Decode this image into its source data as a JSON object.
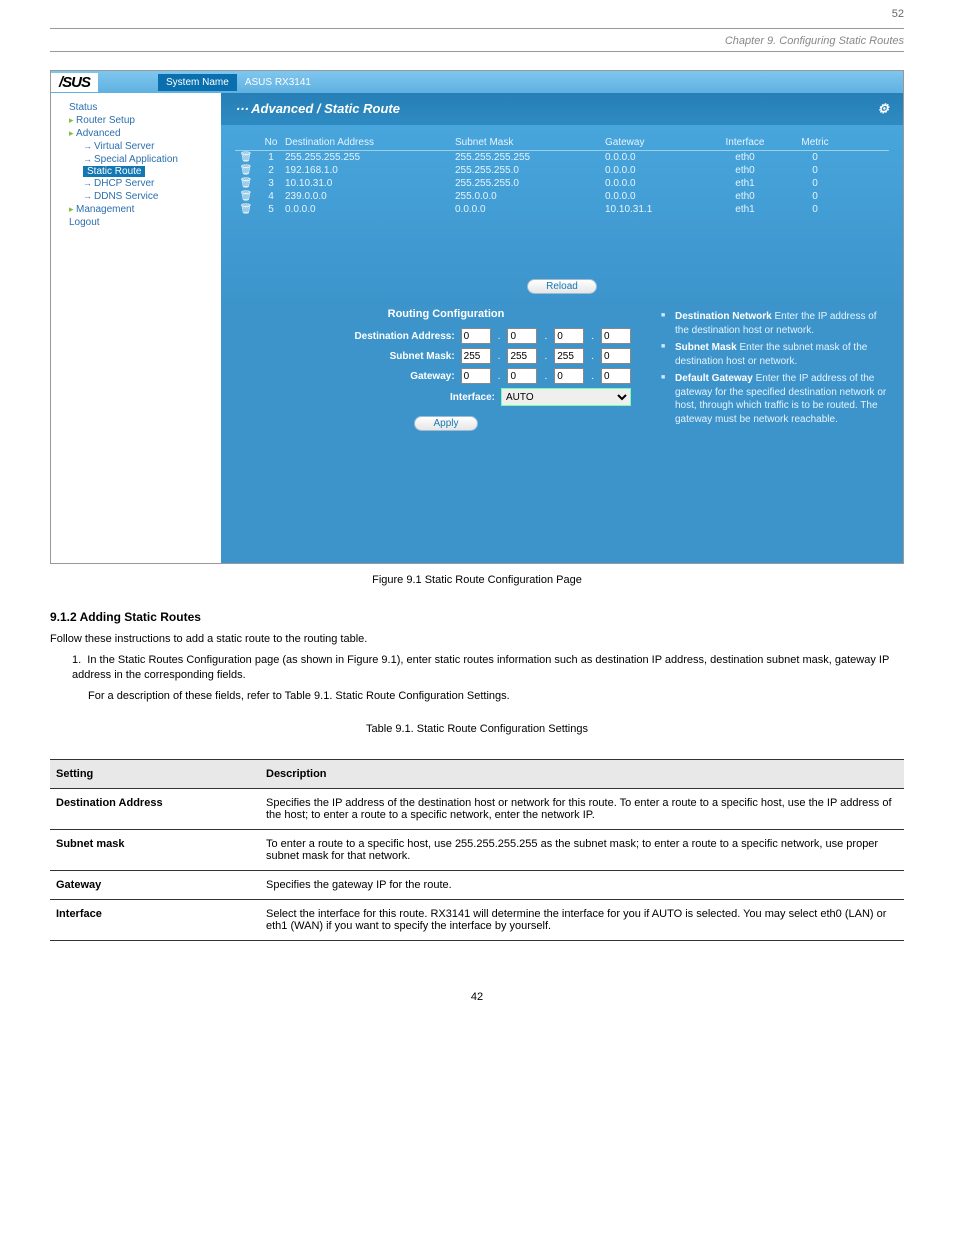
{
  "top_page": "52",
  "chapter_ref": "Chapter 9. Configuring Static Routes",
  "sys_name_label": "System Name",
  "sys_name_value": "ASUS RX3141",
  "crumb": "Advanced / Static Route",
  "sidebar": {
    "items": [
      {
        "label": "Status"
      },
      {
        "label": "Router Setup"
      },
      {
        "label": "Advanced"
      },
      {
        "label": "Virtual Server"
      },
      {
        "label": "Special Application"
      },
      {
        "label": "Static Route"
      },
      {
        "label": "DHCP Server"
      },
      {
        "label": "DDNS Service"
      },
      {
        "label": "Management"
      },
      {
        "label": "Logout"
      }
    ]
  },
  "th": {
    "no": "No",
    "da": "Destination Address",
    "sm": "Subnet Mask",
    "gw": "Gateway",
    "if": "Interface",
    "mt": "Metric"
  },
  "rows": [
    {
      "no": "1",
      "da": "255.255.255.255",
      "sm": "255.255.255.255",
      "gw": "0.0.0.0",
      "if": "eth0",
      "mt": "0"
    },
    {
      "no": "2",
      "da": "192.168.1.0",
      "sm": "255.255.255.0",
      "gw": "0.0.0.0",
      "if": "eth0",
      "mt": "0"
    },
    {
      "no": "3",
      "da": "10.10.31.0",
      "sm": "255.255.255.0",
      "gw": "0.0.0.0",
      "if": "eth1",
      "mt": "0"
    },
    {
      "no": "4",
      "da": "239.0.0.0",
      "sm": "255.0.0.0",
      "gw": "0.0.0.0",
      "if": "eth0",
      "mt": "0"
    },
    {
      "no": "5",
      "da": "0.0.0.0",
      "sm": "0.0.0.0",
      "gw": "10.10.31.1",
      "if": "eth1",
      "mt": "0"
    }
  ],
  "reload": "Reload",
  "form": {
    "title": "Routing Configuration",
    "da_label": "Destination Address:",
    "sm_label": "Subnet Mask:",
    "gw_label": "Gateway:",
    "if_label": "Interface:",
    "da": [
      "0",
      "0",
      "0",
      "0"
    ],
    "sm": [
      "255",
      "255",
      "255",
      "0"
    ],
    "gw": [
      "0",
      "0",
      "0",
      "0"
    ],
    "if": "AUTO",
    "apply": "Apply"
  },
  "help": {
    "dn_b": "Destination Network",
    "dn_t": " Enter the IP address of the destination host or network.",
    "sm_b": "Subnet Mask",
    "sm_t": " Enter the subnet mask of the destination host or network.",
    "dg_b": "Default Gateway",
    "dg_t": " Enter the IP address of the gateway for the specified destination network or host, through which traffic is to be routed. The gateway must be network reachable."
  },
  "caption": "Figure 9.1 Static Route Configuration Page",
  "sec_912": "9.1.2 Adding Static Routes",
  "sec_912_p": "Follow these instructions to add a static route to the routing table.",
  "sec_912_s1": "In the Static Routes Configuration page (as shown in Figure 9.1), enter static routes information such as destination IP address, destination subnet mask, gateway IP address in the corresponding fields.",
  "sec_912_s2": "For a description of these fields, refer to Table 9.1. Static Route Configuration Settings.",
  "table_caption": "Table 9.1. Static Route Configuration Settings",
  "ft": {
    "h1": "Setting",
    "h2": "Description",
    "r1a": "Destination Address",
    "r1b": "Specifies the IP address of the destination host or network for this route. To enter a route to a specific host, use the IP address of the host; to enter a route to a specific network, enter the network IP.",
    "r2a": "Subnet mask",
    "r2b": "To enter a route to a specific host, use 255.255.255.255 as the subnet mask; to enter a route to a specific network, use proper subnet mask for that network.",
    "r3a": "Gateway",
    "r3b": "Specifies the gateway IP for the route.",
    "r4a": "Interface",
    "r4b": "Select the interface for this route. RX3141 will determine the interface for you if AUTO is selected. You may select eth0 (LAN) or eth1 (WAN) if you want to specify the interface by yourself."
  },
  "footer_page": "42"
}
